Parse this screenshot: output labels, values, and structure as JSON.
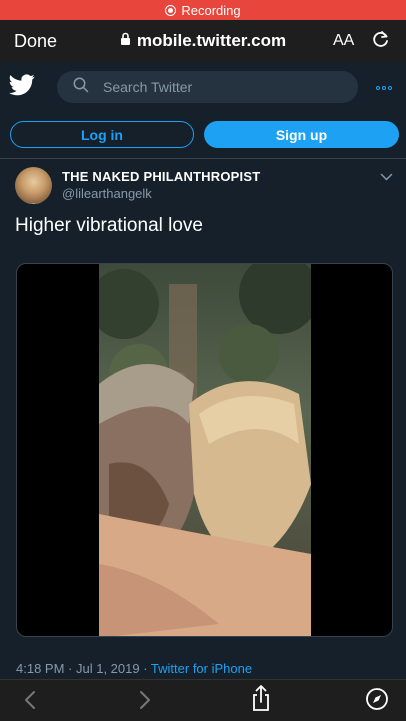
{
  "recording": {
    "label": "Recording"
  },
  "safari": {
    "done_label": "Done",
    "url": "mobile.twitter.com",
    "text_size_label": "AA"
  },
  "twitter": {
    "search_placeholder": "Search Twitter",
    "login_label": "Log in",
    "signup_label": "Sign up"
  },
  "tweet": {
    "display_name": "THE NAKED PHILANTHROPIST",
    "handle": "@lilearthangelk",
    "text": "Higher vibrational love",
    "time": "4:18 PM",
    "date": "Jul 1, 2019",
    "source": "Twitter for iPhone"
  },
  "colors": {
    "accent": "#1da1f2",
    "background": "#15202b",
    "recording": "#e8453c"
  },
  "icons": [
    "lock-icon",
    "reload-icon",
    "twitter-bird-icon",
    "search-icon",
    "more-icon",
    "chevron-down-icon",
    "back-icon",
    "forward-icon",
    "share-icon",
    "compass-icon"
  ]
}
